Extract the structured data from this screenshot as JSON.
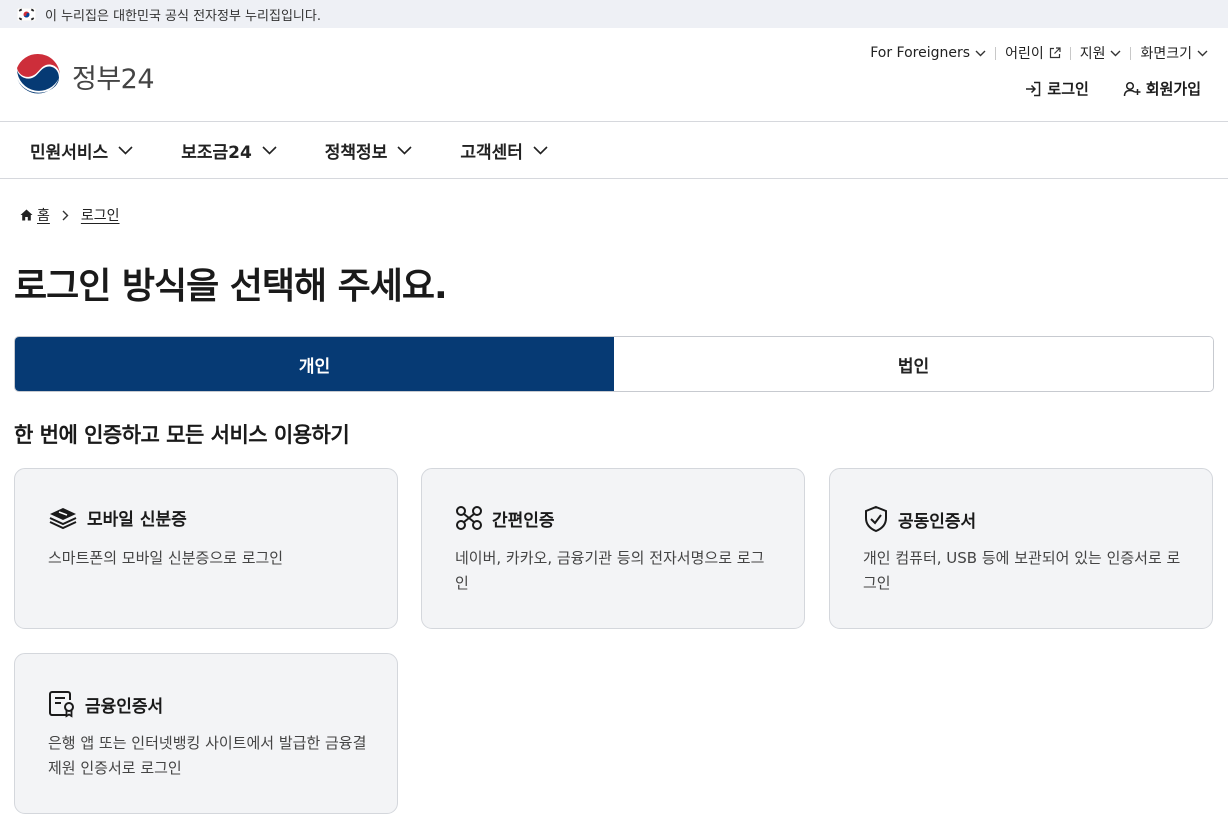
{
  "banner": {
    "text": "이 누리집은 대한민국 공식 전자정부 누리집입니다."
  },
  "logo": {
    "text": "정부24"
  },
  "util_nav": [
    {
      "label": "For Foreigners",
      "icon": "chevron-down-icon"
    },
    {
      "label": "어린이",
      "icon": "external-link-icon"
    },
    {
      "label": "지원",
      "icon": "chevron-down-icon"
    },
    {
      "label": "화면크기",
      "icon": "chevron-down-icon"
    }
  ],
  "auth": {
    "login": "로그인",
    "signup": "회원가입"
  },
  "gnb": [
    "민원서비스",
    "보조금24",
    "정책정보",
    "고객센터"
  ],
  "breadcrumb": {
    "home": "홈",
    "current": "로그인"
  },
  "page_title": "로그인 방식을 선택해 주세요.",
  "tabs": {
    "personal": "개인",
    "corporate": "법인",
    "active": "personal"
  },
  "section_title": "한 번에 인증하고 모든 서비스 이용하기",
  "cards": [
    {
      "title": "모바일 신분증",
      "desc": "스마트폰의 모바일 신분증으로 로그인",
      "icon": "mobile-id-icon"
    },
    {
      "title": "간편인증",
      "desc": "네이버, 카카오, 금융기관 등의 전자서명으로 로그인",
      "icon": "simple-auth-icon"
    },
    {
      "title": "공동인증서",
      "desc": "개인 컴퓨터, USB 등에 보관되어 있는 인증서로 로그인",
      "icon": "shield-check-icon"
    },
    {
      "title": "금융인증서",
      "desc": "은행 앱 또는 인터넷뱅킹 사이트에서 발급한 금융결제원 인증서로 로그인",
      "icon": "certificate-icon"
    }
  ],
  "colors": {
    "primary": "#063a74",
    "card_bg": "#f3f4f6",
    "banner_bg": "#eef0f5"
  }
}
